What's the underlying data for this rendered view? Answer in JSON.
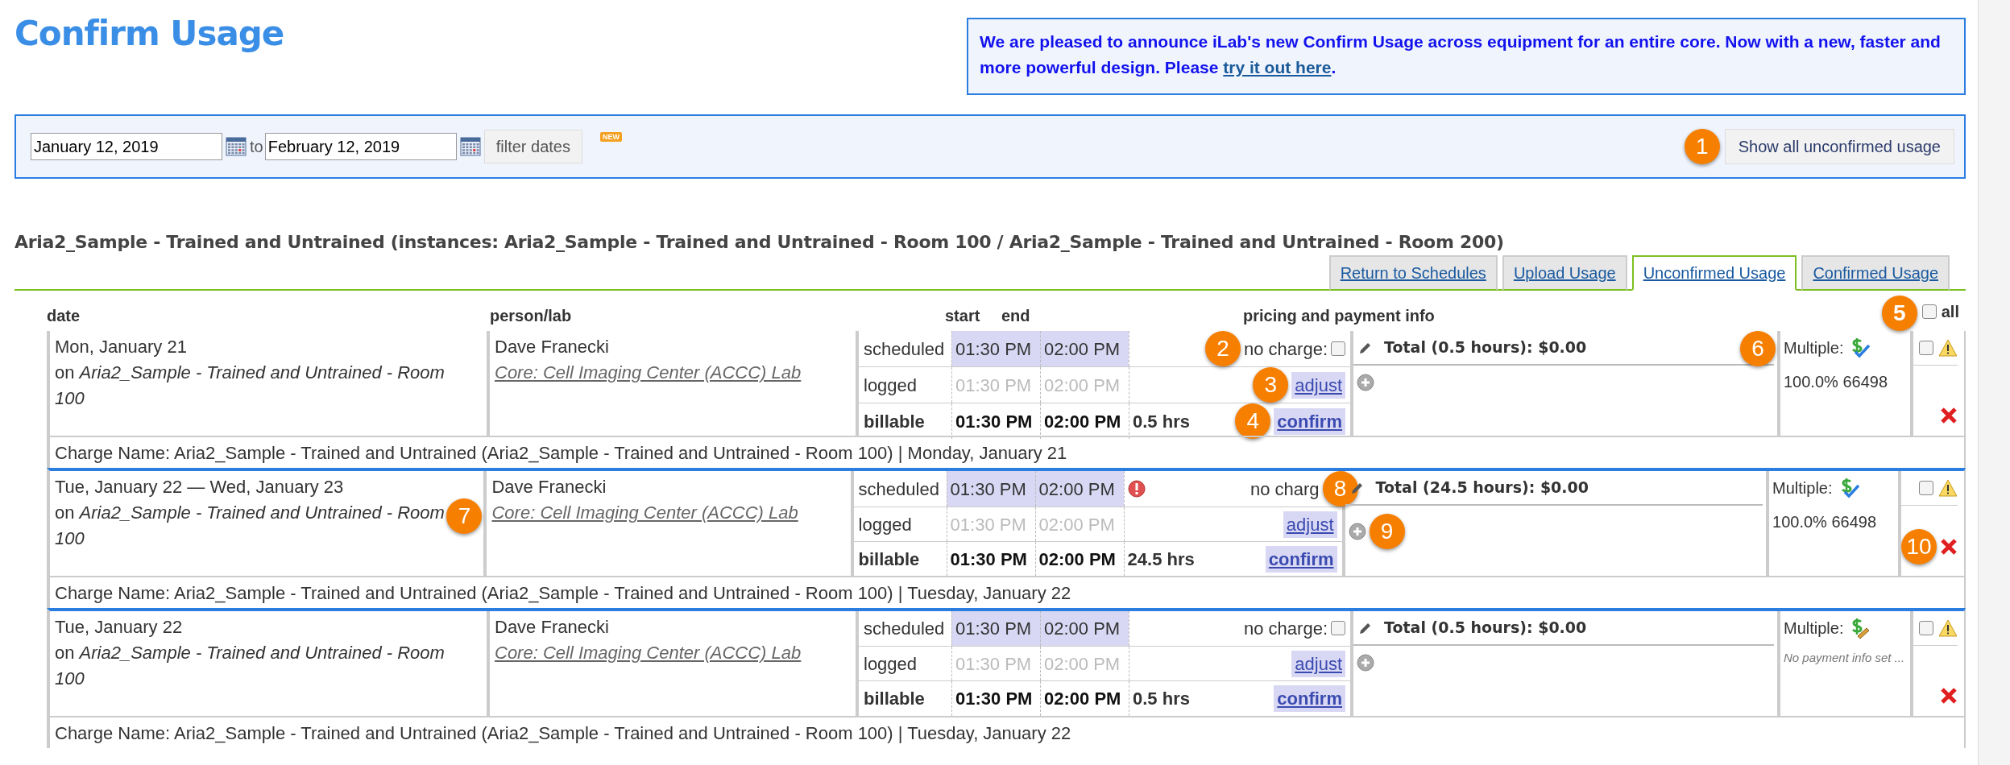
{
  "page": {
    "title": "Confirm Usage"
  },
  "announcement": {
    "text": "We are pleased to announce iLab's new Confirm Usage across equipment for an entire core. Now with a new, faster and more powerful design. Please",
    "link": "try it out here",
    "suffix": "."
  },
  "filter": {
    "from": "January 12, 2019",
    "to_label": "to",
    "to": "February 12, 2019",
    "button": "filter dates",
    "new_badge": "NEW",
    "show_all_button": "Show all unconfirmed usage",
    "show_all_callout": "1"
  },
  "section_title": "Aria2_Sample - Trained and Untrained (instances: Aria2_Sample - Trained and Untrained - Room 100 / Aria2_Sample - Trained and Untrained - Room 200)",
  "tabs": [
    {
      "label": "Return to Schedules",
      "selected": false
    },
    {
      "label": "Upload Usage",
      "selected": false
    },
    {
      "label": "Unconfirmed Usage",
      "selected": true
    },
    {
      "label": "Confirmed Usage",
      "selected": false
    }
  ],
  "table": {
    "columns": {
      "date": "date",
      "person": "person/lab",
      "start": "start",
      "end": "end",
      "pricing": "pricing and payment info",
      "all": "all"
    },
    "select_all_checked": false,
    "select_all_callout": "5",
    "rows": [
      {
        "date": "Mon, January 21",
        "location": "on *Aria2_Sample - Trained and Untrained - Room 100*",
        "person": "Dave Franecki",
        "lab": "Core: Cell Imaging Center (ACCC) Lab",
        "times": [
          {
            "label": "scheduled",
            "start": "01:30 PM",
            "end": "02:00 PM"
          },
          {
            "label": "logged",
            "start": "01:30 PM",
            "end": "02:00 PM"
          },
          {
            "label": "billable",
            "start": "01:30 PM",
            "end": "02:00 PM",
            "hours": "0.5 hrs"
          }
        ],
        "warning": false,
        "no_charge": {
          "label": "no charge:",
          "checked": false,
          "callout": "2"
        },
        "adjust": "adjust",
        "adjust_callout": "3",
        "confirm": "confirm",
        "confirm_callout": "4",
        "total": "Total (0.5 hours): $0.00",
        "payment_label": "Multiple:",
        "payment_callout": "6",
        "payment_info": "100.0% 66498",
        "payment_missing": false,
        "selected": false,
        "charge_name": "Charge Name: Aria2_Sample - Trained and Untrained (Aria2_Sample - Trained and Untrained - Room 100) | Monday, January 21"
      },
      {
        "date": "Tue, January 22 — Wed, January 23",
        "location": "on *Aria2_Sample - Trained and Untrained - Room 100*",
        "date_callout": "7",
        "person": "Dave Franecki",
        "lab": "Core: Cell Imaging Center (ACCC) Lab",
        "times": [
          {
            "label": "scheduled",
            "start": "01:30 PM",
            "end": "02:00 PM"
          },
          {
            "label": "logged",
            "start": "01:30 PM",
            "end": "02:00 PM"
          },
          {
            "label": "billable",
            "start": "01:30 PM",
            "end": "02:00 PM",
            "hours": "24.5 hrs"
          }
        ],
        "warning": true,
        "no_charge": {
          "label": "no charg",
          "callout": "8"
        },
        "adjust": "adjust",
        "confirm": "confirm",
        "add_callout": "9",
        "total": "Total (24.5 hours): $0.00",
        "payment_label": "Multiple:",
        "payment_info": "100.0% 66498",
        "payment_missing": false,
        "selected": false,
        "delete_callout": "10",
        "charge_name": "Charge Name: Aria2_Sample - Trained and Untrained (Aria2_Sample - Trained and Untrained - Room 100) | Tuesday, January 22"
      },
      {
        "date": "Tue, January 22",
        "location": "on *Aria2_Sample - Trained and Untrained - Room 100*",
        "person": "Dave Franecki",
        "lab": "Core: Cell Imaging Center (ACCC) Lab",
        "times": [
          {
            "label": "scheduled",
            "start": "01:30 PM",
            "end": "02:00 PM"
          },
          {
            "label": "logged",
            "start": "01:30 PM",
            "end": "02:00 PM"
          },
          {
            "label": "billable",
            "start": "01:30 PM",
            "end": "02:00 PM",
            "hours": "0.5 hrs"
          }
        ],
        "warning": false,
        "no_charge": {
          "label": "no charge:",
          "checked": false
        },
        "adjust": "adjust",
        "confirm": "confirm",
        "total": "Total (0.5 hours): $0.00",
        "payment_label": "Multiple:",
        "payment_info": "No payment info set ...",
        "payment_missing": true,
        "selected": false,
        "charge_name": "Charge Name: Aria2_Sample - Trained and Untrained (Aria2_Sample - Trained and Untrained - Room 100) | Tuesday, January 22"
      }
    ]
  }
}
